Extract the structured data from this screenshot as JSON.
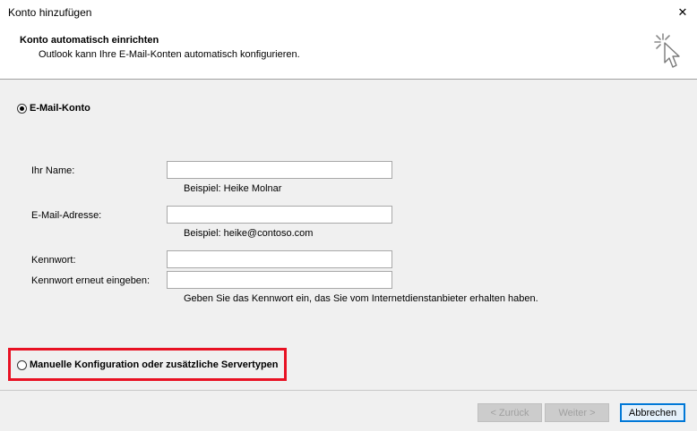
{
  "window": {
    "title": "Konto hinzufügen",
    "close_glyph": "✕"
  },
  "header": {
    "title": "Konto automatisch einrichten",
    "subtitle": "Outlook kann Ihre E-Mail-Konten automatisch konfigurieren.",
    "icon": "setup-wizard-cursor-icon"
  },
  "options": {
    "email_account": {
      "label": "E-Mail-Konto",
      "selected": true
    },
    "manual": {
      "label": "Manuelle Konfiguration oder zusätzliche Servertypen",
      "selected": false
    }
  },
  "form": {
    "name": {
      "label": "Ihr Name:",
      "value": "",
      "hint": "Beispiel: Heike Molnar"
    },
    "email": {
      "label": "E-Mail-Adresse:",
      "value": "",
      "hint": "Beispiel: heike@contoso.com"
    },
    "password": {
      "label": "Kennwort:",
      "value": ""
    },
    "password_confirm": {
      "label": "Kennwort erneut eingeben:",
      "value": ""
    },
    "password_hint": "Geben Sie das Kennwort ein, das Sie vom Internetdienstanbieter erhalten haben."
  },
  "buttons": {
    "back": "< Zurück",
    "next": "Weiter >",
    "cancel": "Abbrechen"
  },
  "colors": {
    "highlight": "#e81123",
    "primary_border": "#0078d7"
  }
}
